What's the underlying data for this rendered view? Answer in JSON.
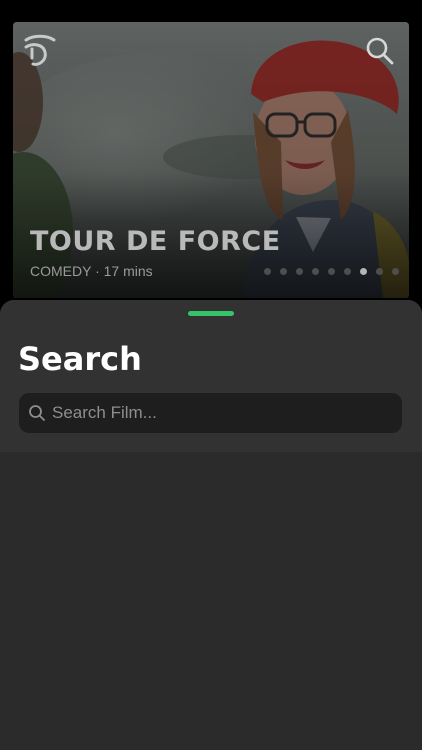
{
  "hero": {
    "title": "TOUR DE FORCE",
    "meta": "COMEDY · 17 mins",
    "slide_count": 9,
    "active_slide_index": 6
  },
  "icons": {
    "logo": "brand-logo-icon",
    "search": "search-icon"
  },
  "search_sheet": {
    "title": "Search",
    "placeholder": "Search Film...",
    "value": ""
  },
  "colors": {
    "grabber": "#35c46a",
    "sheet_background": "#2b2b2b",
    "input_background": "#1e1e1e"
  }
}
